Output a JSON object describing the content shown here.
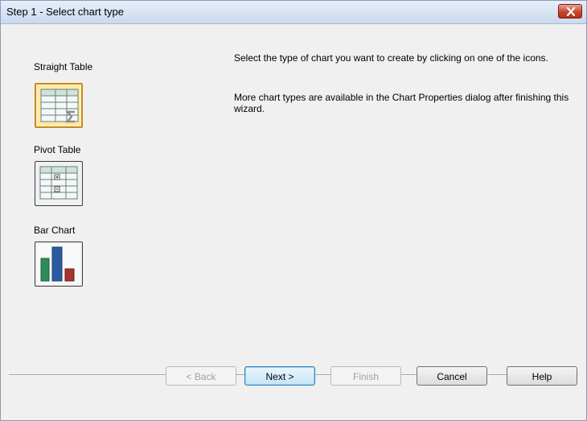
{
  "window": {
    "title": "Step 1 - Select chart type"
  },
  "options": [
    {
      "label": "Straight Table",
      "icon": "straight-table-icon",
      "selected": true
    },
    {
      "label": "Pivot Table",
      "icon": "pivot-table-icon",
      "selected": false
    },
    {
      "label": "Bar Chart",
      "icon": "bar-chart-icon",
      "selected": false
    }
  ],
  "description": {
    "line1": "Select the type of chart you want to create by clicking on one of the icons.",
    "line2": "More chart types are available in the Chart Properties dialog after finishing this wizard."
  },
  "buttons": {
    "back": "< Back",
    "next": "Next >",
    "finish": "Finish",
    "cancel": "Cancel",
    "help": "Help"
  },
  "colors": {
    "selected_border": "#c78a18",
    "selected_fill": "#fde9a7",
    "close_button": "#c9452f",
    "bar_green": "#2e8b57",
    "bar_blue": "#2c5aa0",
    "bar_red": "#a8322d"
  }
}
